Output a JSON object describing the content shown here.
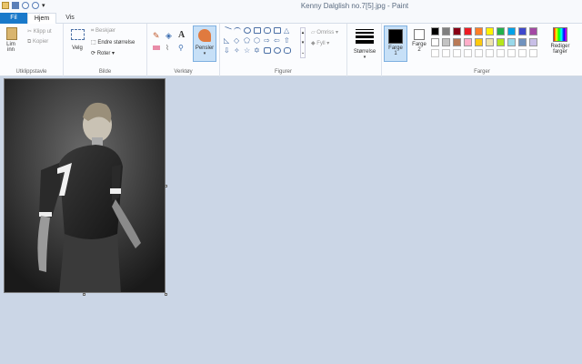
{
  "window": {
    "title": "Kenny Dalglish no.7[5].jpg - Paint"
  },
  "tabs": [
    {
      "label": "Fil"
    },
    {
      "label": "Hjem"
    },
    {
      "label": "Vis"
    }
  ],
  "clipboard": {
    "paste_label": "Lim inn",
    "cut_label": "Klipp ut",
    "copy_label": "Kopier",
    "group_label": "Utklippstavle"
  },
  "image_group": {
    "select_label": "Velg",
    "crop_label": "Beskjær",
    "resize_label": "Endre størrelse",
    "rotate_label": "Roter",
    "group_label": "Bilde"
  },
  "tools": {
    "group_label": "Verktøy",
    "brushes_label": "Pensler"
  },
  "shapes": {
    "group_label": "Figurer",
    "outline_label": "Omriss",
    "fill_label": "Fyll"
  },
  "size": {
    "label": "Størrelse"
  },
  "colors": {
    "color1_label": "Farge 1",
    "color2_label": "Farge 2",
    "edit_label": "Rediger farger",
    "group_label": "Farger",
    "row1": [
      "#000000",
      "#7f7f7f",
      "#880015",
      "#ed1c24",
      "#ff7f27",
      "#fff200",
      "#22b14c",
      "#00a2e8",
      "#3f48cc",
      "#a349a4"
    ],
    "row2": [
      "#ffffff",
      "#c3c3c3",
      "#b97a57",
      "#ffaec9",
      "#ffc90e",
      "#efe4b0",
      "#b5e61d",
      "#99d9ea",
      "#7092be",
      "#c8bfe7"
    ],
    "row3": [
      "#ffffff",
      "#ffffff",
      "#ffffff",
      "#ffffff",
      "#ffffff",
      "#ffffff",
      "#ffffff",
      "#ffffff",
      "#ffffff",
      "#ffffff"
    ],
    "accent": "#1979ca"
  },
  "canvas": {
    "image_description": "black-and-white photo"
  }
}
